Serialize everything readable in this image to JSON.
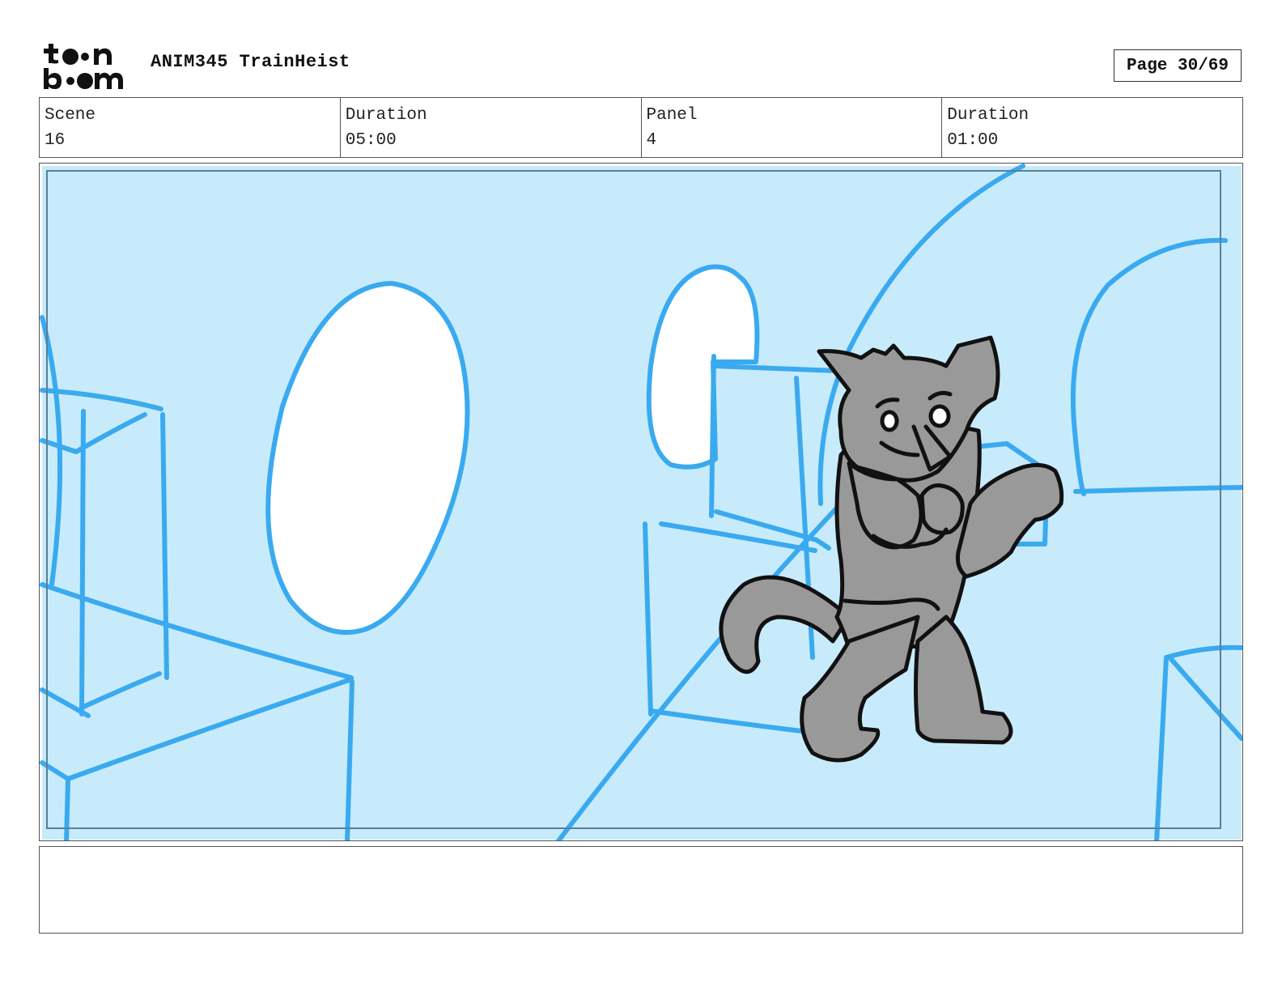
{
  "header": {
    "logo_text": "toonboom",
    "project_title": "ANIM345 TrainHeist",
    "page_label": "Page 30/69"
  },
  "info": {
    "scene_label": "Scene",
    "scene_value": "16",
    "scene_duration_label": "Duration",
    "scene_duration_value": "05:00",
    "panel_label": "Panel",
    "panel_value": "4",
    "panel_duration_label": "Duration",
    "panel_duration_value": "01:00"
  },
  "panel": {
    "background_color": "#c8ebfc",
    "line_color": "#3aaaf0",
    "character_fill": "#999999"
  },
  "notes": {
    "text": ""
  }
}
